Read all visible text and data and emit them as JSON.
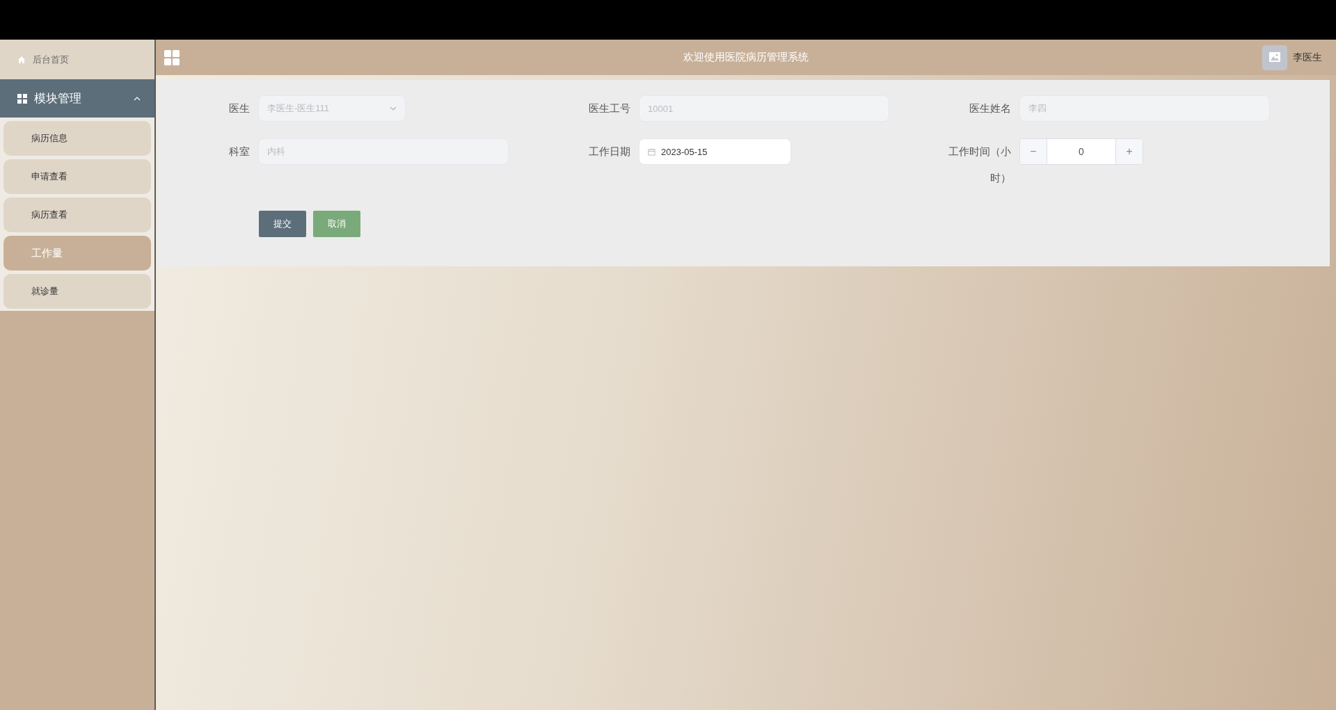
{
  "sidebar": {
    "home": {
      "label": "后台首页"
    },
    "group": {
      "label": "模块管理",
      "expanded": true,
      "items": [
        {
          "label": "病历信息",
          "selected": false
        },
        {
          "label": "申请查看",
          "selected": false
        },
        {
          "label": "病历查看",
          "selected": false
        },
        {
          "label": "工作量",
          "selected": true
        },
        {
          "label": "就诊量",
          "selected": false
        }
      ]
    }
  },
  "header": {
    "title": "欢迎使用医院病历管理系统",
    "user": "李医生"
  },
  "form": {
    "fields": [
      {
        "kind": "select",
        "label": "医生",
        "value": "李医生-医生111",
        "disabled": true
      },
      {
        "kind": "text",
        "label": "医生工号",
        "value": "10001",
        "disabled": true
      },
      {
        "kind": "text",
        "label": "医生姓名",
        "value": "李四",
        "disabled": true
      },
      {
        "kind": "text",
        "label": "科室",
        "value": "内科",
        "disabled": true
      },
      {
        "kind": "date",
        "label": "工作日期",
        "value": "2023-05-15",
        "disabled": false
      },
      {
        "kind": "number",
        "label": "工作时间（小时）",
        "value": "0",
        "disabled": false,
        "minus": "−",
        "plus": "+"
      }
    ],
    "buttons": [
      {
        "label": "提交",
        "kind": "primary"
      },
      {
        "label": "取消",
        "kind": "success"
      }
    ]
  }
}
